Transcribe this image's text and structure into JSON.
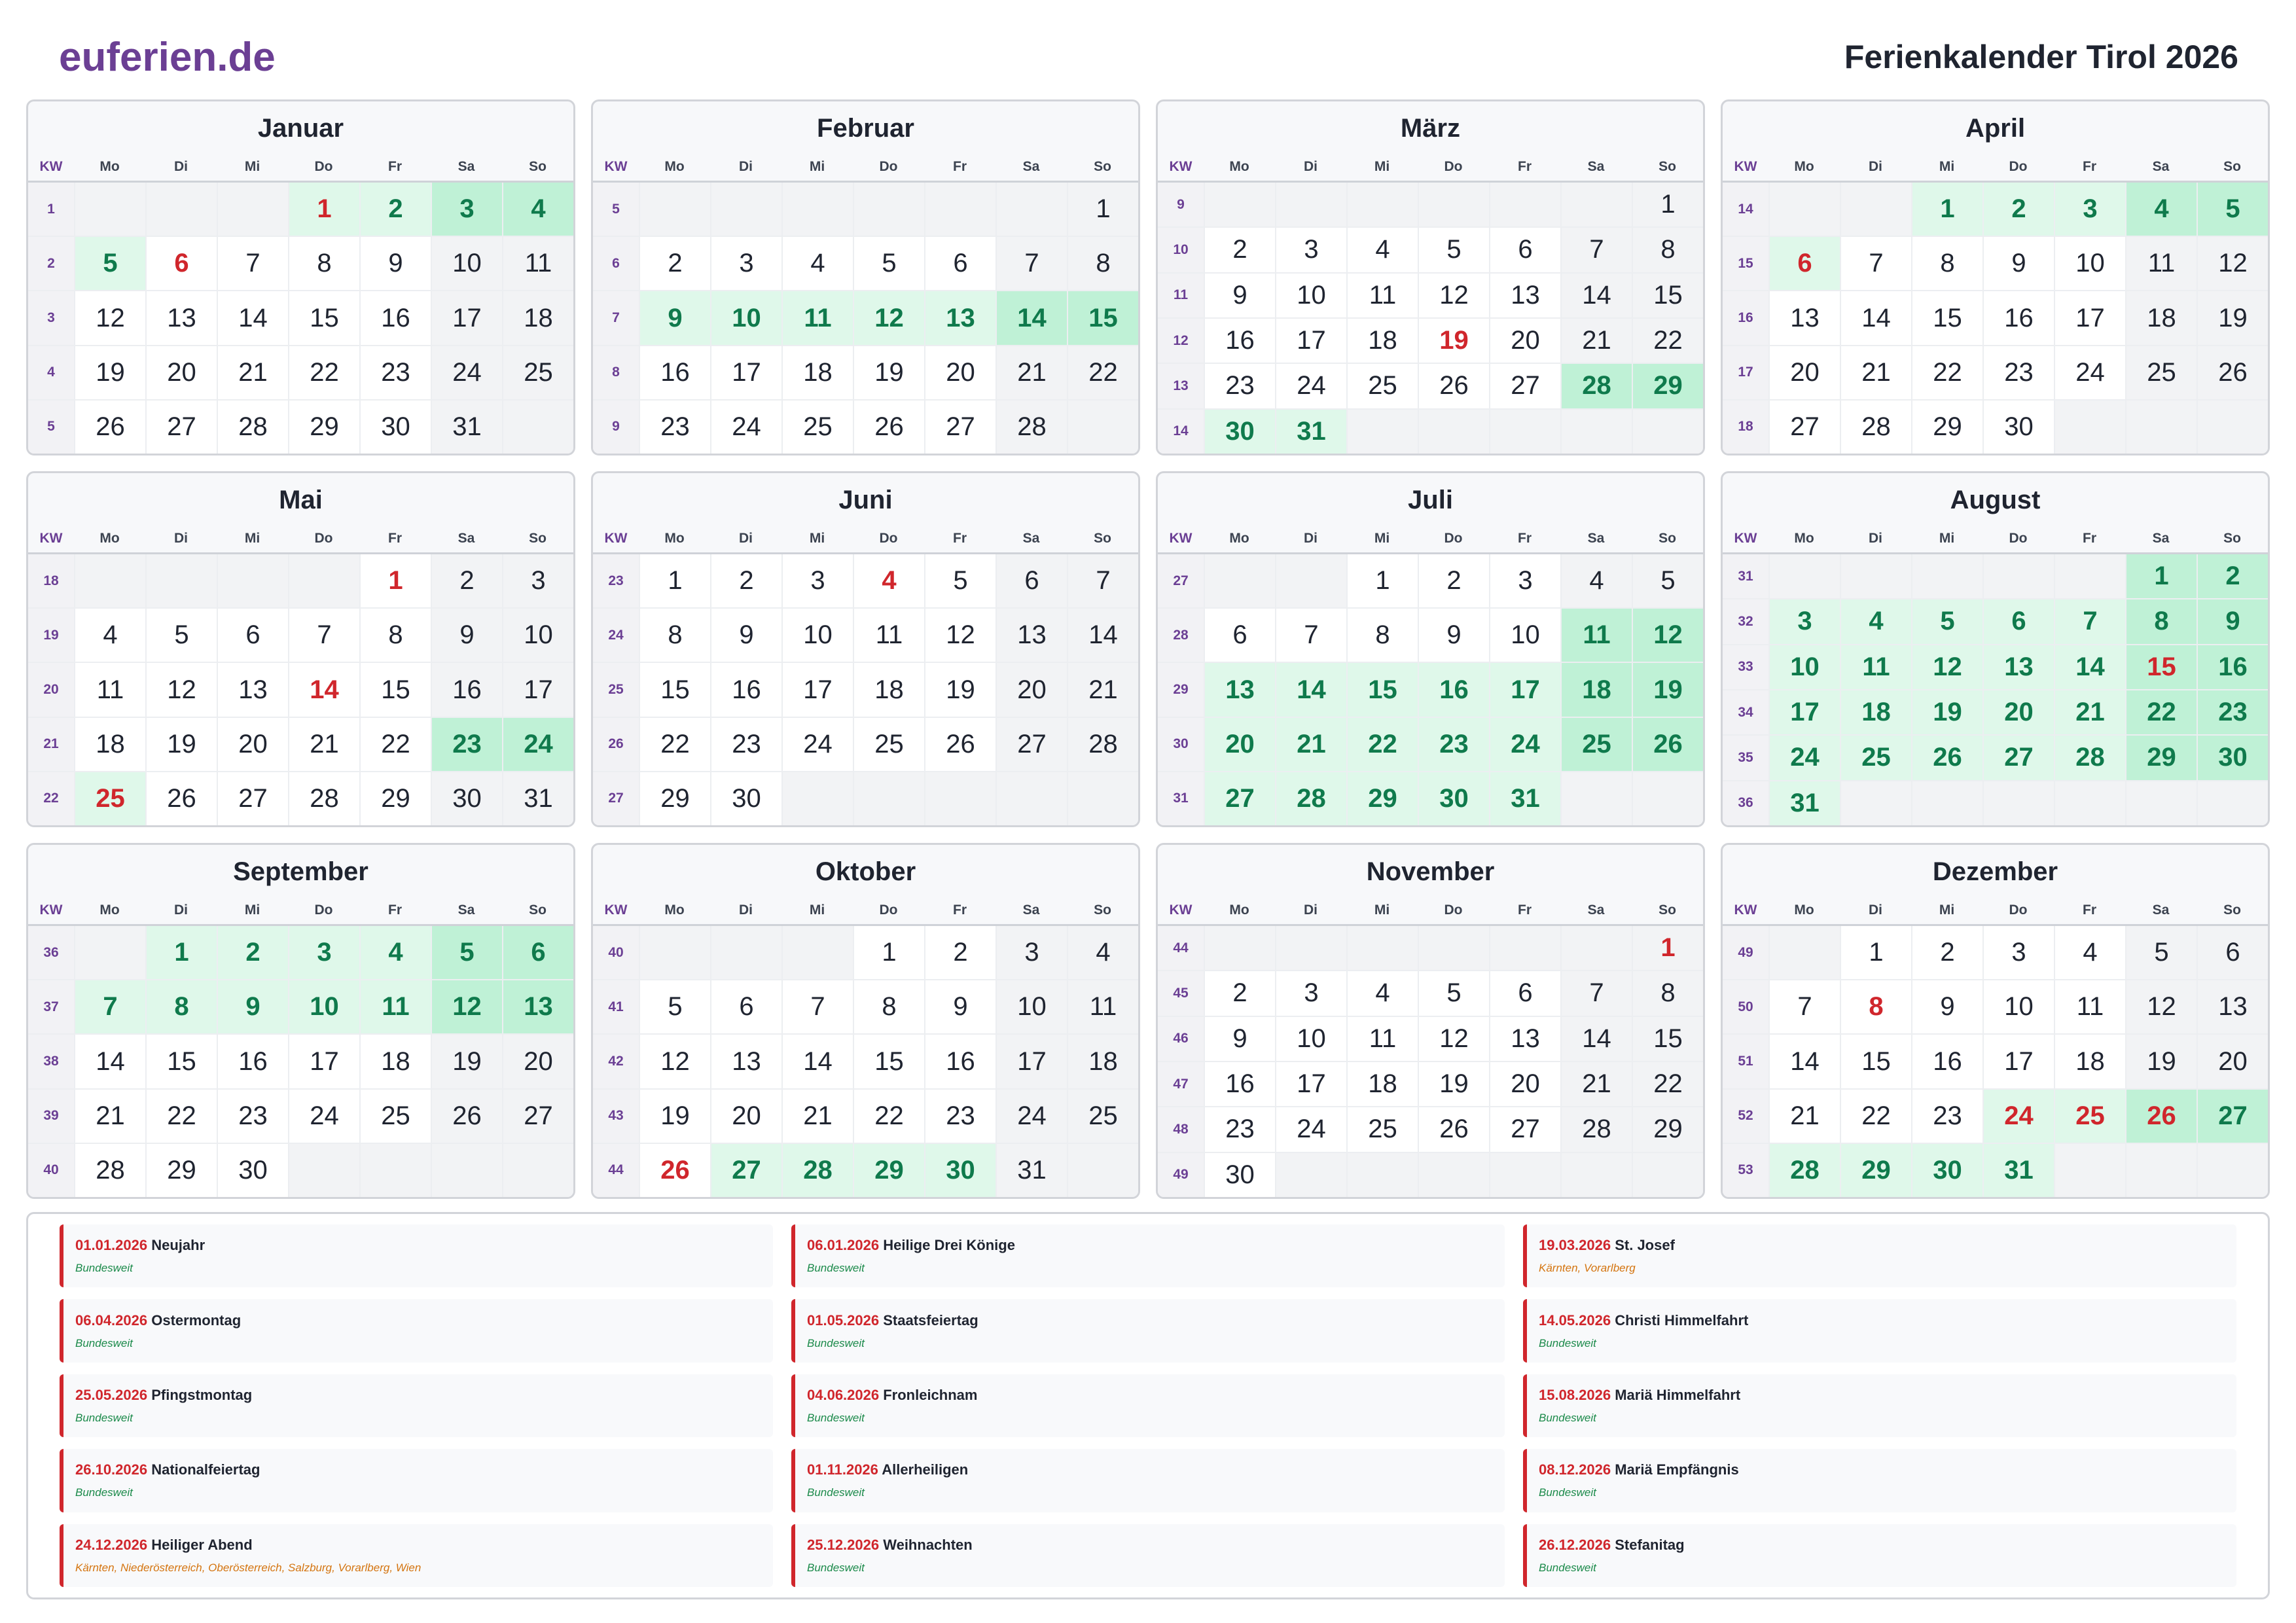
{
  "header": {
    "logo": "euferien.de",
    "title": "Ferienkalender Tirol 2026"
  },
  "weekday_labels": [
    "KW",
    "Mo",
    "Di",
    "Mi",
    "Do",
    "Fr",
    "Sa",
    "So"
  ],
  "colors": {
    "brand": "#6b3f94",
    "holiday_red": "#d0262c",
    "school_holiday_green": "#0f7a4c"
  },
  "months": [
    {
      "name": "Januar",
      "weeks": [
        {
          "kw": "1",
          "days": [
            "",
            "",
            "",
            "1",
            "2",
            "3",
            "4"
          ]
        },
        {
          "kw": "2",
          "days": [
            "5",
            "6",
            "7",
            "8",
            "9",
            "10",
            "11"
          ]
        },
        {
          "kw": "3",
          "days": [
            "12",
            "13",
            "14",
            "15",
            "16",
            "17",
            "18"
          ]
        },
        {
          "kw": "4",
          "days": [
            "19",
            "20",
            "21",
            "22",
            "23",
            "24",
            "25"
          ]
        },
        {
          "kw": "5",
          "days": [
            "26",
            "27",
            "28",
            "29",
            "30",
            "31",
            ""
          ]
        }
      ],
      "school": [
        "1",
        "2",
        "3",
        "4",
        "5"
      ],
      "feiertage": [
        "1",
        "6"
      ]
    },
    {
      "name": "Februar",
      "weeks": [
        {
          "kw": "5",
          "days": [
            "",
            "",
            "",
            "",
            "",
            "",
            "1"
          ]
        },
        {
          "kw": "6",
          "days": [
            "2",
            "3",
            "4",
            "5",
            "6",
            "7",
            "8"
          ]
        },
        {
          "kw": "7",
          "days": [
            "9",
            "10",
            "11",
            "12",
            "13",
            "14",
            "15"
          ]
        },
        {
          "kw": "8",
          "days": [
            "16",
            "17",
            "18",
            "19",
            "20",
            "21",
            "22"
          ]
        },
        {
          "kw": "9",
          "days": [
            "23",
            "24",
            "25",
            "26",
            "27",
            "28",
            ""
          ]
        }
      ],
      "school": [
        "9",
        "10",
        "11",
        "12",
        "13",
        "14",
        "15"
      ],
      "feiertage": []
    },
    {
      "name": "März",
      "weeks": [
        {
          "kw": "9",
          "days": [
            "",
            "",
            "",
            "",
            "",
            "",
            "1"
          ]
        },
        {
          "kw": "10",
          "days": [
            "2",
            "3",
            "4",
            "5",
            "6",
            "7",
            "8"
          ]
        },
        {
          "kw": "11",
          "days": [
            "9",
            "10",
            "11",
            "12",
            "13",
            "14",
            "15"
          ]
        },
        {
          "kw": "12",
          "days": [
            "16",
            "17",
            "18",
            "19",
            "20",
            "21",
            "22"
          ]
        },
        {
          "kw": "13",
          "days": [
            "23",
            "24",
            "25",
            "26",
            "27",
            "28",
            "29"
          ]
        },
        {
          "kw": "14",
          "days": [
            "30",
            "31",
            "",
            "",
            "",
            "",
            ""
          ]
        }
      ],
      "school": [
        "28",
        "29",
        "30",
        "31"
      ],
      "feiertage": [
        "19"
      ]
    },
    {
      "name": "April",
      "weeks": [
        {
          "kw": "14",
          "days": [
            "",
            "",
            "1",
            "2",
            "3",
            "4",
            "5"
          ]
        },
        {
          "kw": "15",
          "days": [
            "6",
            "7",
            "8",
            "9",
            "10",
            "11",
            "12"
          ]
        },
        {
          "kw": "16",
          "days": [
            "13",
            "14",
            "15",
            "16",
            "17",
            "18",
            "19"
          ]
        },
        {
          "kw": "17",
          "days": [
            "20",
            "21",
            "22",
            "23",
            "24",
            "25",
            "26"
          ]
        },
        {
          "kw": "18",
          "days": [
            "27",
            "28",
            "29",
            "30",
            "",
            "",
            ""
          ]
        }
      ],
      "school": [
        "1",
        "2",
        "3",
        "4",
        "5",
        "6"
      ],
      "feiertage": [
        "6"
      ]
    },
    {
      "name": "Mai",
      "weeks": [
        {
          "kw": "18",
          "days": [
            "",
            "",
            "",
            "",
            "1",
            "2",
            "3"
          ]
        },
        {
          "kw": "19",
          "days": [
            "4",
            "5",
            "6",
            "7",
            "8",
            "9",
            "10"
          ]
        },
        {
          "kw": "20",
          "days": [
            "11",
            "12",
            "13",
            "14",
            "15",
            "16",
            "17"
          ]
        },
        {
          "kw": "21",
          "days": [
            "18",
            "19",
            "20",
            "21",
            "22",
            "23",
            "24"
          ]
        },
        {
          "kw": "22",
          "days": [
            "25",
            "26",
            "27",
            "28",
            "29",
            "30",
            "31"
          ]
        }
      ],
      "school": [
        "23",
        "24",
        "25"
      ],
      "feiertage": [
        "1",
        "14",
        "25"
      ]
    },
    {
      "name": "Juni",
      "weeks": [
        {
          "kw": "23",
          "days": [
            "1",
            "2",
            "3",
            "4",
            "5",
            "6",
            "7"
          ]
        },
        {
          "kw": "24",
          "days": [
            "8",
            "9",
            "10",
            "11",
            "12",
            "13",
            "14"
          ]
        },
        {
          "kw": "25",
          "days": [
            "15",
            "16",
            "17",
            "18",
            "19",
            "20",
            "21"
          ]
        },
        {
          "kw": "26",
          "days": [
            "22",
            "23",
            "24",
            "25",
            "26",
            "27",
            "28"
          ]
        },
        {
          "kw": "27",
          "days": [
            "29",
            "30",
            "",
            "",
            "",
            "",
            ""
          ]
        }
      ],
      "school": [],
      "feiertage": [
        "4"
      ]
    },
    {
      "name": "Juli",
      "weeks": [
        {
          "kw": "27",
          "days": [
            "",
            "",
            "1",
            "2",
            "3",
            "4",
            "5"
          ]
        },
        {
          "kw": "28",
          "days": [
            "6",
            "7",
            "8",
            "9",
            "10",
            "11",
            "12"
          ]
        },
        {
          "kw": "29",
          "days": [
            "13",
            "14",
            "15",
            "16",
            "17",
            "18",
            "19"
          ]
        },
        {
          "kw": "30",
          "days": [
            "20",
            "21",
            "22",
            "23",
            "24",
            "25",
            "26"
          ]
        },
        {
          "kw": "31",
          "days": [
            "27",
            "28",
            "29",
            "30",
            "31",
            "",
            ""
          ]
        }
      ],
      "school": [
        "11",
        "12",
        "13",
        "14",
        "15",
        "16",
        "17",
        "18",
        "19",
        "20",
        "21",
        "22",
        "23",
        "24",
        "25",
        "26",
        "27",
        "28",
        "29",
        "30",
        "31"
      ],
      "feiertage": []
    },
    {
      "name": "August",
      "weeks": [
        {
          "kw": "31",
          "days": [
            "",
            "",
            "",
            "",
            "",
            "1",
            "2"
          ]
        },
        {
          "kw": "32",
          "days": [
            "3",
            "4",
            "5",
            "6",
            "7",
            "8",
            "9"
          ]
        },
        {
          "kw": "33",
          "days": [
            "10",
            "11",
            "12",
            "13",
            "14",
            "15",
            "16"
          ]
        },
        {
          "kw": "34",
          "days": [
            "17",
            "18",
            "19",
            "20",
            "21",
            "22",
            "23"
          ]
        },
        {
          "kw": "35",
          "days": [
            "24",
            "25",
            "26",
            "27",
            "28",
            "29",
            "30"
          ]
        },
        {
          "kw": "36",
          "days": [
            "31",
            "",
            "",
            "",
            "",
            "",
            ""
          ]
        }
      ],
      "school": [
        "1",
        "2",
        "3",
        "4",
        "5",
        "6",
        "7",
        "8",
        "9",
        "10",
        "11",
        "12",
        "13",
        "14",
        "15",
        "16",
        "17",
        "18",
        "19",
        "20",
        "21",
        "22",
        "23",
        "24",
        "25",
        "26",
        "27",
        "28",
        "29",
        "30",
        "31"
      ],
      "feiertage": [
        "15"
      ]
    },
    {
      "name": "September",
      "weeks": [
        {
          "kw": "36",
          "days": [
            "",
            "1",
            "2",
            "3",
            "4",
            "5",
            "6"
          ]
        },
        {
          "kw": "37",
          "days": [
            "7",
            "8",
            "9",
            "10",
            "11",
            "12",
            "13"
          ]
        },
        {
          "kw": "38",
          "days": [
            "14",
            "15",
            "16",
            "17",
            "18",
            "19",
            "20"
          ]
        },
        {
          "kw": "39",
          "days": [
            "21",
            "22",
            "23",
            "24",
            "25",
            "26",
            "27"
          ]
        },
        {
          "kw": "40",
          "days": [
            "28",
            "29",
            "30",
            "",
            "",
            "",
            ""
          ]
        }
      ],
      "school": [
        "1",
        "2",
        "3",
        "4",
        "5",
        "6",
        "7",
        "8",
        "9",
        "10",
        "11",
        "12",
        "13"
      ],
      "feiertage": []
    },
    {
      "name": "Oktober",
      "weeks": [
        {
          "kw": "40",
          "days": [
            "",
            "",
            "",
            "1",
            "2",
            "3",
            "4"
          ]
        },
        {
          "kw": "41",
          "days": [
            "5",
            "6",
            "7",
            "8",
            "9",
            "10",
            "11"
          ]
        },
        {
          "kw": "42",
          "days": [
            "12",
            "13",
            "14",
            "15",
            "16",
            "17",
            "18"
          ]
        },
        {
          "kw": "43",
          "days": [
            "19",
            "20",
            "21",
            "22",
            "23",
            "24",
            "25"
          ]
        },
        {
          "kw": "44",
          "days": [
            "26",
            "27",
            "28",
            "29",
            "30",
            "31",
            ""
          ]
        }
      ],
      "school": [
        "27",
        "28",
        "29",
        "30"
      ],
      "feiertage": [
        "26"
      ]
    },
    {
      "name": "November",
      "weeks": [
        {
          "kw": "44",
          "days": [
            "",
            "",
            "",
            "",
            "",
            "",
            "1"
          ]
        },
        {
          "kw": "45",
          "days": [
            "2",
            "3",
            "4",
            "5",
            "6",
            "7",
            "8"
          ]
        },
        {
          "kw": "46",
          "days": [
            "9",
            "10",
            "11",
            "12",
            "13",
            "14",
            "15"
          ]
        },
        {
          "kw": "47",
          "days": [
            "16",
            "17",
            "18",
            "19",
            "20",
            "21",
            "22"
          ]
        },
        {
          "kw": "48",
          "days": [
            "23",
            "24",
            "25",
            "26",
            "27",
            "28",
            "29"
          ]
        },
        {
          "kw": "49",
          "days": [
            "30",
            "",
            "",
            "",
            "",
            "",
            ""
          ]
        }
      ],
      "school": [],
      "feiertage": [
        "1"
      ]
    },
    {
      "name": "Dezember",
      "weeks": [
        {
          "kw": "49",
          "days": [
            "",
            "1",
            "2",
            "3",
            "4",
            "5",
            "6"
          ]
        },
        {
          "kw": "50",
          "days": [
            "7",
            "8",
            "9",
            "10",
            "11",
            "12",
            "13"
          ]
        },
        {
          "kw": "51",
          "days": [
            "14",
            "15",
            "16",
            "17",
            "18",
            "19",
            "20"
          ]
        },
        {
          "kw": "52",
          "days": [
            "21",
            "22",
            "23",
            "24",
            "25",
            "26",
            "27"
          ]
        },
        {
          "kw": "53",
          "days": [
            "28",
            "29",
            "30",
            "31",
            "",
            "",
            ""
          ]
        }
      ],
      "school": [
        "24",
        "25",
        "26",
        "27",
        "28",
        "29",
        "30",
        "31"
      ],
      "feiertage": [
        "8",
        "24",
        "25",
        "26"
      ]
    }
  ],
  "holidays": [
    {
      "date": "01.01.2026",
      "name": "Neujahr",
      "region": "Bundesweit",
      "region_color": "green"
    },
    {
      "date": "06.01.2026",
      "name": "Heilige Drei Könige",
      "region": "Bundesweit",
      "region_color": "green"
    },
    {
      "date": "19.03.2026",
      "name": "St. Josef",
      "region": "Kärnten, Vorarlberg",
      "region_color": "orange"
    },
    {
      "date": "06.04.2026",
      "name": "Ostermontag",
      "region": "Bundesweit",
      "region_color": "green"
    },
    {
      "date": "01.05.2026",
      "name": "Staatsfeiertag",
      "region": "Bundesweit",
      "region_color": "green"
    },
    {
      "date": "14.05.2026",
      "name": "Christi Himmelfahrt",
      "region": "Bundesweit",
      "region_color": "green"
    },
    {
      "date": "25.05.2026",
      "name": "Pfingstmontag",
      "region": "Bundesweit",
      "region_color": "green"
    },
    {
      "date": "04.06.2026",
      "name": "Fronleichnam",
      "region": "Bundesweit",
      "region_color": "green"
    },
    {
      "date": "15.08.2026",
      "name": "Mariä Himmelfahrt",
      "region": "Bundesweit",
      "region_color": "green"
    },
    {
      "date": "26.10.2026",
      "name": "Nationalfeiertag",
      "region": "Bundesweit",
      "region_color": "green"
    },
    {
      "date": "01.11.2026",
      "name": "Allerheiligen",
      "region": "Bundesweit",
      "region_color": "green"
    },
    {
      "date": "08.12.2026",
      "name": "Mariä Empfängnis",
      "region": "Bundesweit",
      "region_color": "green"
    },
    {
      "date": "24.12.2026",
      "name": "Heiliger Abend",
      "region": "Kärnten, Niederösterreich, Oberösterreich, Salzburg, Vorarlberg, Wien",
      "region_color": "orange"
    },
    {
      "date": "25.12.2026",
      "name": "Weihnachten",
      "region": "Bundesweit",
      "region_color": "green"
    },
    {
      "date": "26.12.2026",
      "name": "Stefanitag",
      "region": "Bundesweit",
      "region_color": "green"
    }
  ]
}
